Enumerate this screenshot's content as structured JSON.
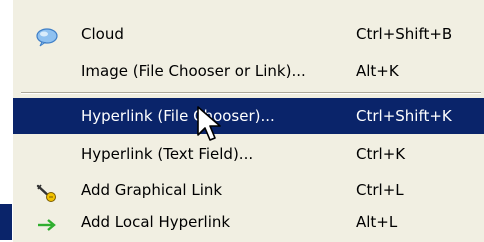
{
  "menu": {
    "items": [
      {
        "label": "Cloud",
        "shortcut": "Ctrl+Shift+B",
        "icon": "cloud-icon"
      },
      {
        "label": "Image (File Chooser or Link)...",
        "shortcut": "Alt+K",
        "icon": ""
      },
      {
        "label": "Hyperlink (File Chooser)...",
        "shortcut": "Ctrl+Shift+K",
        "icon": "",
        "selected": true
      },
      {
        "label": "Hyperlink (Text Field)...",
        "shortcut": "Ctrl+K",
        "icon": ""
      },
      {
        "label": "Add Graphical Link",
        "shortcut": "Ctrl+L",
        "icon": "graphical-link-icon"
      },
      {
        "label": "Add Local Hyperlink",
        "shortcut": "Alt+L",
        "icon": "green-arrow-icon"
      }
    ]
  },
  "colors": {
    "menu_background": "#f1efe2",
    "selection": "#0a246a",
    "separator": "#aca899",
    "arrow_green": "#2fae2f"
  }
}
